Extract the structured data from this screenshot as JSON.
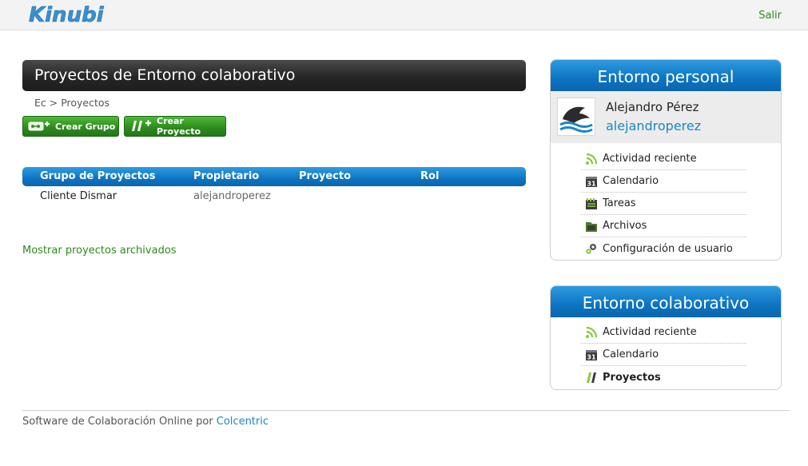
{
  "header": {
    "logo_text": "Kinubi",
    "logout_label": "Salir"
  },
  "main": {
    "title": "Proyectos de Entorno colaborativo",
    "breadcrumb": "Ec > Proyectos",
    "buttons": {
      "create_group": "Crear Grupo",
      "create_project": "Crear Proyecto"
    },
    "table": {
      "columns": [
        "Grupo de Proyectos",
        "Propietario",
        "Proyecto",
        "Rol"
      ],
      "rows": [
        {
          "group": "Cliente Dismar",
          "owner": "alejandroperez",
          "project": "",
          "role": ""
        }
      ]
    },
    "show_archived_link": "Mostrar proyectos archivados"
  },
  "personal_panel": {
    "title": "Entorno personal",
    "user": {
      "name": "Alejandro Pérez",
      "login": "alejandroperez"
    },
    "items": [
      {
        "label": "Actividad reciente",
        "icon": "rss-icon"
      },
      {
        "label": "Calendario",
        "icon": "calendar-icon"
      },
      {
        "label": "Tareas",
        "icon": "tasks-icon"
      },
      {
        "label": "Archivos",
        "icon": "files-icon"
      },
      {
        "label": "Configuración de usuario",
        "icon": "settings-icon"
      }
    ]
  },
  "collab_panel": {
    "title": "Entorno colaborativo",
    "items": [
      {
        "label": "Actividad reciente",
        "icon": "rss-icon"
      },
      {
        "label": "Calendario",
        "icon": "calendar-icon"
      },
      {
        "label": "Proyectos",
        "icon": "projects-icon",
        "active": true
      }
    ]
  },
  "footer": {
    "text": "Software de Colaboración Online por ",
    "link": "Colcentric"
  },
  "colors": {
    "accent_blue": "#0d74c2",
    "accent_green": "#2f8d1e",
    "title_bar": "#262626"
  }
}
